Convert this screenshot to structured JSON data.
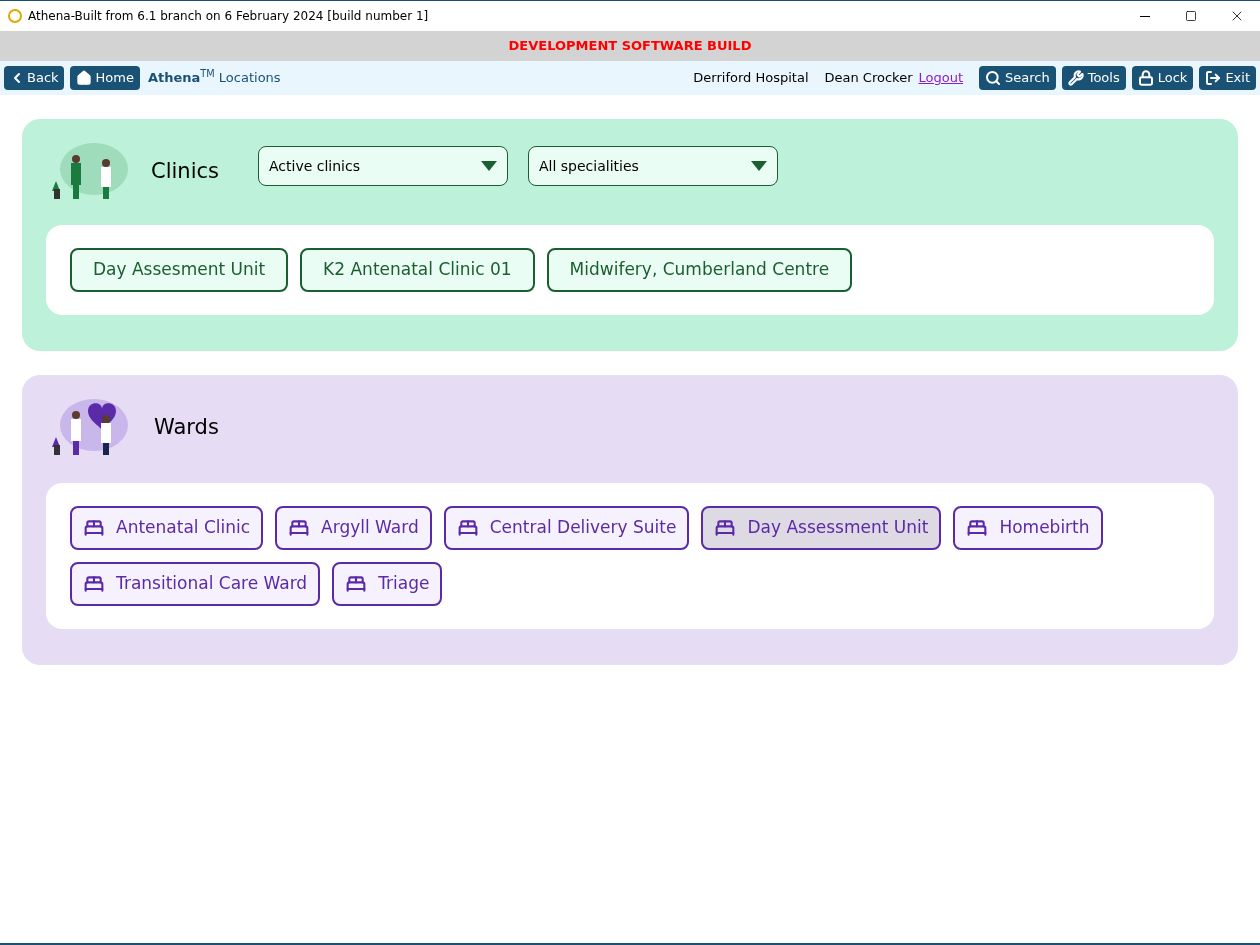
{
  "window": {
    "title": "Athena-Built from 6.1 branch on 6 February 2024 [build number 1]"
  },
  "banner": "DEVELOPMENT SOFTWARE BUILD",
  "nav": {
    "back": "Back",
    "home": "Home",
    "breadcrumb": "**Athena**$^{TM}$ Locations",
    "hospital": "Derriford Hospital",
    "user": "Dean Crocker",
    "logout": "Logout",
    "actions": [
      {
        "kind": "search",
        "label": "Search"
      },
      {
        "kind": "tools",
        "label": "Tools"
      },
      {
        "kind": "lock",
        "label": "Lock"
      },
      {
        "kind": "exit",
        "label": "Exit"
      }
    ]
  },
  "clinics": {
    "title": "Clinics",
    "filters": [
      {
        "value": "Active clinics"
      },
      {
        "value": "All specialities"
      }
    ],
    "items": [
      {
        "label": "Day Assesment Unit"
      },
      {
        "label": "K2 Antenatal Clinic 01"
      },
      {
        "label": "Midwifery, Cumberland Centre"
      }
    ]
  },
  "wards": {
    "title": "Wards",
    "items": [
      {
        "label": "Antenatal Clinic",
        "selected": false
      },
      {
        "label": "Argyll Ward",
        "selected": false
      },
      {
        "label": "Central Delivery Suite",
        "selected": false
      },
      {
        "label": "Day Assessment Unit",
        "selected": true
      },
      {
        "label": "Homebirth",
        "selected": false
      },
      {
        "label": "Transitional Care Ward",
        "selected": false
      },
      {
        "label": "Triage",
        "selected": false
      }
    ]
  }
}
